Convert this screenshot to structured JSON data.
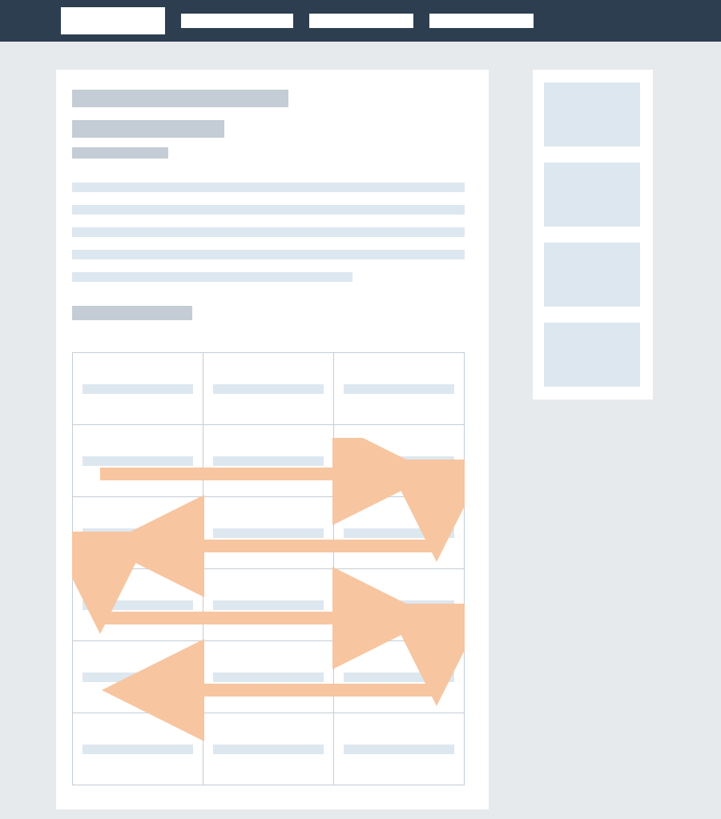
{
  "diagram": {
    "type": "wireframe",
    "description": "Generic webpage wireframe illustrating a serpentine reading/tab order through a data table",
    "colors": {
      "topbar": "#2c3e50",
      "page_bg": "#e7eaed",
      "card_bg": "#ffffff",
      "dark_placeholder": "#c4cdd5",
      "light_placeholder": "#dde7ef",
      "arrow": "#f7c59f"
    }
  },
  "topbar": {
    "logo_label": "",
    "nav_items": [
      "",
      "",
      ""
    ]
  },
  "main": {
    "title": "",
    "subtitle": "",
    "meta": "",
    "body_lines": [
      "",
      "",
      "",
      "",
      ""
    ],
    "section_heading": "",
    "table": {
      "rows": 6,
      "cols": 3,
      "cells": [
        [
          "",
          "",
          ""
        ],
        [
          "",
          "",
          ""
        ],
        [
          "",
          "",
          ""
        ],
        [
          "",
          "",
          ""
        ],
        [
          "",
          "",
          ""
        ],
        [
          "",
          "",
          ""
        ]
      ],
      "reading_order": "serpentine_left_to_right_then_right_to_left"
    }
  },
  "sidebar": {
    "tiles": [
      "",
      "",
      "",
      ""
    ]
  },
  "arrows": [
    {
      "from_row": 0,
      "direction": "right"
    },
    {
      "from_row": 0,
      "to_row": 1,
      "direction": "down"
    },
    {
      "from_row": 1,
      "direction": "left"
    },
    {
      "from_row": 1,
      "to_row": 2,
      "direction": "down"
    },
    {
      "from_row": 2,
      "direction": "right"
    },
    {
      "from_row": 2,
      "to_row": 3,
      "direction": "down"
    },
    {
      "from_row": 3,
      "direction": "left"
    }
  ]
}
